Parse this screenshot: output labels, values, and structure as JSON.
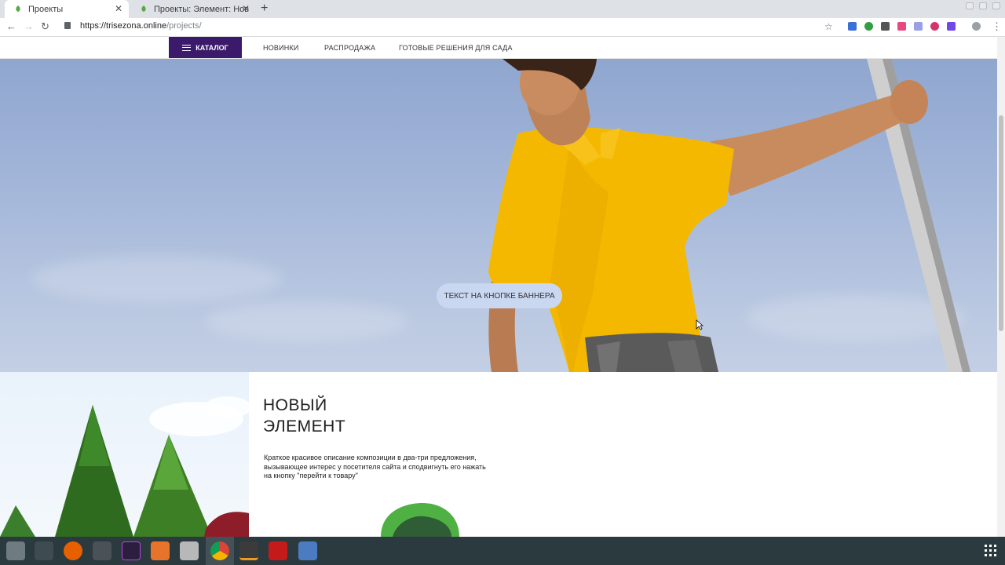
{
  "browser": {
    "tabs": [
      {
        "title": "Проекты",
        "active": true
      },
      {
        "title": "Проекты: Элемент: Нов",
        "active": false
      }
    ],
    "new_tab_label": "+",
    "close_glyph": "✕",
    "url_host": "https://trisezona.online",
    "url_path": "/projects/",
    "back_glyph": "←",
    "forward_glyph": "→",
    "reload_glyph": "↻",
    "star_glyph": "☆",
    "menu_glyph": "⋮"
  },
  "site_nav": {
    "catalog_label": "КАТАЛОГ",
    "links": [
      "НОВИНКИ",
      "РАСПРОДАЖА",
      "ГОТОВЫЕ РЕШЕНИЯ ДЛЯ САДА"
    ],
    "accent_color": "#3b1a6b"
  },
  "hero": {
    "button_label": "ТЕКСТ НА КНОПКЕ БАННЕРА"
  },
  "element": {
    "title_line1": "НОВЫЙ",
    "title_line2": "ЭЛЕМЕНТ",
    "description": "Краткое красивое описание композиции в два-три предложения, вызывающее интерес у посетителя сайта и сподвигнуть его нажать на кнопку \"перейти к товару\""
  },
  "taskbar": {
    "apps": [
      "settings-icon",
      "hammer-icon",
      "firefox-icon",
      "calculator-icon",
      "phpstorm-icon",
      "store-icon",
      "files-icon",
      "chrome-icon",
      "sublime-icon",
      "filezilla-icon",
      "monitor-icon"
    ],
    "selected": "chrome-icon"
  }
}
